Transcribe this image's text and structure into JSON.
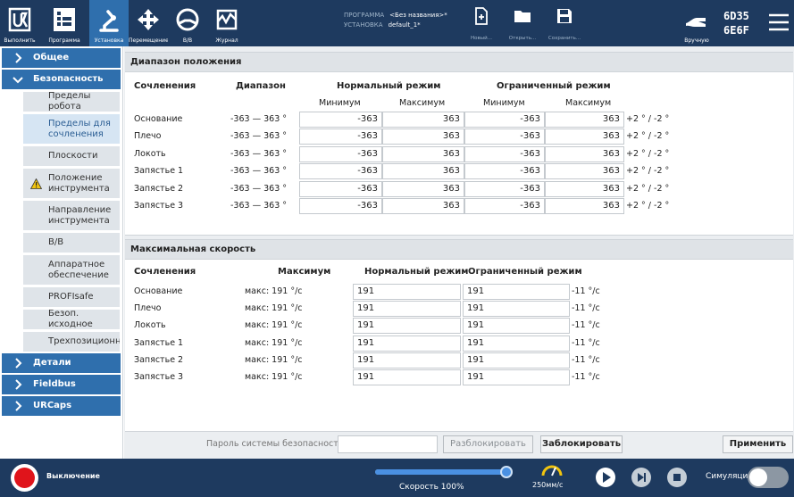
{
  "topbar": {
    "nav": [
      {
        "label": "Выполнить"
      },
      {
        "label": "Программа"
      },
      {
        "label": "Установка"
      },
      {
        "label": "Перемещение"
      },
      {
        "label": "В/В"
      },
      {
        "label": "Журнал"
      }
    ],
    "program_label": "ПРОГРАММА",
    "program_value": "<Без названия>*",
    "install_label": "УСТАНОВКА",
    "install_value": "default_1*",
    "file_buttons": [
      {
        "label": "Новый..."
      },
      {
        "label": "Открыть..."
      },
      {
        "label": "Сохранить..."
      }
    ],
    "manual_label": "Вручную",
    "code_line1": "6D35",
    "code_line2": "6E6F"
  },
  "sidebar": {
    "general": "Общее",
    "safety": "Безопасность",
    "items": [
      "Пределы робота",
      "Пределы для сочленения",
      "Плоскости",
      "Положение инструмента",
      "Направление инструмента",
      "В/В",
      "Аппаратное обеспечение",
      "PROFIsafe",
      "Безоп. исходное",
      "Трехпозиционный"
    ],
    "details": "Детали",
    "fieldbus": "Fieldbus",
    "urcaps": "URCaps"
  },
  "position": {
    "title": "Диапазон положения",
    "col_joints": "Сочленения",
    "col_range": "Диапазон",
    "col_normal": "Нормальный режим",
    "col_reduced": "Ограниченный режим",
    "min_label": "Минимум",
    "max_label": "Максимум",
    "rows": [
      {
        "joint": "Основание",
        "range": "-363 — 363 °",
        "nmin": "-363",
        "nmax": "363",
        "rmin": "-363",
        "rmax": "363",
        "tol": "+2 ° / -2 °"
      },
      {
        "joint": "Плечо",
        "range": "-363 — 363 °",
        "nmin": "-363",
        "nmax": "363",
        "rmin": "-363",
        "rmax": "363",
        "tol": "+2 ° / -2 °"
      },
      {
        "joint": "Локоть",
        "range": "-363 — 363 °",
        "nmin": "-363",
        "nmax": "363",
        "rmin": "-363",
        "rmax": "363",
        "tol": "+2 ° / -2 °"
      },
      {
        "joint": "Запястье 1",
        "range": "-363 — 363 °",
        "nmin": "-363",
        "nmax": "363",
        "rmin": "-363",
        "rmax": "363",
        "tol": "+2 ° / -2 °"
      },
      {
        "joint": "Запястье 2",
        "range": "-363 — 363 °",
        "nmin": "-363",
        "nmax": "363",
        "rmin": "-363",
        "rmax": "363",
        "tol": "+2 ° / -2 °"
      },
      {
        "joint": "Запястье 3",
        "range": "-363 — 363 °",
        "nmin": "-363",
        "nmax": "363",
        "rmin": "-363",
        "rmax": "363",
        "tol": "+2 ° / -2 °"
      }
    ]
  },
  "speed": {
    "title": "Максимальная скорость",
    "col_joints": "Сочленения",
    "col_max": "Максимум",
    "col_normal": "Нормальный режим",
    "col_reduced": "Ограниченный режим",
    "rows": [
      {
        "joint": "Основание",
        "max": "макс: 191 °/с",
        "normal": "191",
        "reduced": "191",
        "tol": "-11 °/с"
      },
      {
        "joint": "Плечо",
        "max": "макс: 191 °/с",
        "normal": "191",
        "reduced": "191",
        "tol": "-11 °/с"
      },
      {
        "joint": "Локоть",
        "max": "макс: 191 °/с",
        "normal": "191",
        "reduced": "191",
        "tol": "-11 °/с"
      },
      {
        "joint": "Запястье 1",
        "max": "макс: 191 °/с",
        "normal": "191",
        "reduced": "191",
        "tol": "-11 °/с"
      },
      {
        "joint": "Запястье 2",
        "max": "макс: 191 °/с",
        "normal": "191",
        "reduced": "191",
        "tol": "-11 °/с"
      },
      {
        "joint": "Запястье 3",
        "max": "макс: 191 °/с",
        "normal": "191",
        "reduced": "191",
        "tol": "-11 °/с"
      }
    ]
  },
  "footer": {
    "password_label": "Пароль системы безопасности",
    "password_value": "",
    "unlock": "Разблокировать",
    "lock": "Заблокировать",
    "apply": "Применить"
  },
  "bottom": {
    "power_status": "Выключение",
    "speed_label": "Скорость 100%",
    "speed_fraction": 1.0,
    "tcp_speed": "250мм/с",
    "simulation": "Симуляция"
  },
  "colors": {
    "header_bg": "#1e3a5f",
    "accent": "#2f6fad",
    "power_red": "#e0141b",
    "warning": "#f1c40f"
  }
}
